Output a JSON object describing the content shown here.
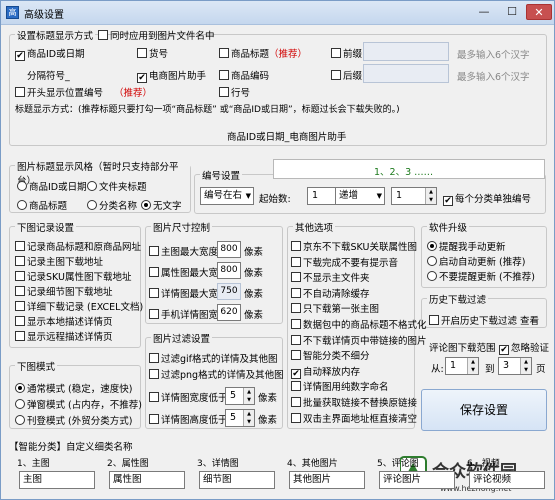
{
  "window": {
    "title": "高级设置",
    "icon": "app-icon",
    "min": "—",
    "max": "☐",
    "close": "✕"
  },
  "title_section": {
    "label": "设置标题显示方式",
    "sync_filename": "同时应用到图片文件名中",
    "cb_id_date": "商品ID或日期",
    "cb_id_date_checked": true,
    "cb_huohao": "货号",
    "cb_title": "商品标题",
    "recommend": "（推荐）",
    "cb_prefix": "前缀",
    "prefix_hint": "最多输入6个汉字",
    "separator_label": "分隔符号_",
    "cb_ec_helper": "电商图片助手",
    "cb_ec_helper_checked": true,
    "cb_code": "商品编码",
    "cb_suffix": "后缀",
    "suffix_hint": "最多输入6个汉字",
    "cb_start_num": "开头显示位置编号",
    "recommend2": "（推荐）",
    "cb_row": "行号",
    "desc": "标题显示方式：(推荐标题只要打勾一项“商品标题” 或“商品ID或日期”，标题过长会下载失败的。)",
    "preview": "商品ID或日期_电商图片助手"
  },
  "style_section": {
    "label": "图片标题显示风格（暂时只支持部分平台）",
    "opts": [
      "商品ID或日期",
      "文件夹标题",
      "商品标题",
      "分类名称",
      "无文字"
    ],
    "selected": 4,
    "numbering": {
      "label": "编号设置",
      "position": "编号在右",
      "start_label": "起始数:",
      "start": "1",
      "mode": "递增",
      "step": "1",
      "per_cat": "每个分类单独编号",
      "per_cat_checked": true
    },
    "preview": "1、2、3 ……"
  },
  "download_log": {
    "label": "下图记录设置",
    "items": [
      "记录商品标题和原商品网址",
      "记录主图下载地址",
      "记录SKU属性图下载地址",
      "记录细节图下载地址",
      "详细下载记录 (EXCEL文档)",
      "显示本地描述详情页",
      "显示远程描述详情页"
    ]
  },
  "download_mode": {
    "label": "下图模式",
    "opts": [
      "通常模式 (稳定，速度快)",
      "弹窗模式 (占内存，不推荐)",
      "刊登模式 (外贸分类方式)"
    ],
    "selected": 0
  },
  "size_section": {
    "label": "图片尺寸控制",
    "unit": "像素",
    "rows": [
      {
        "text": "主图最大宽度:",
        "val": "800",
        "checked": false,
        "disabled": false
      },
      {
        "text": "属性图最大宽度:",
        "val": "800",
        "checked": false,
        "disabled": false
      },
      {
        "text": "详情图最大宽度:",
        "val": "750",
        "checked": false,
        "disabled": true
      },
      {
        "text": "手机详情图宽度:",
        "val": "620",
        "checked": false,
        "disabled": false
      }
    ]
  },
  "filter_section": {
    "label": "图片过滤设置",
    "unit": "像素",
    "items": [
      "过滤gif格式的详情及其他图",
      "过滤png格式的详情及其他图"
    ],
    "rows": [
      {
        "text": "详情图宽度低于:",
        "val": "5"
      },
      {
        "text": "详情图高度低于:",
        "val": "5"
      }
    ]
  },
  "other_section": {
    "label": "其他选项",
    "items": [
      {
        "t": "京东不下载SKU关联属性图",
        "c": false
      },
      {
        "t": "下载完成不要有提示音",
        "c": false
      },
      {
        "t": "不显示主文件夹",
        "c": false
      },
      {
        "t": "不自动清除缓存",
        "c": false
      },
      {
        "t": "只下载第一张主图",
        "c": false
      },
      {
        "t": "数据包中的商品标题不格式化",
        "c": false
      },
      {
        "t": "不下载详情页中带链接的图片",
        "c": false
      },
      {
        "t": "智能分类不细分",
        "c": false
      },
      {
        "t": "自动释放内存",
        "c": true
      },
      {
        "t": "详情图用纯数字命名",
        "c": false
      },
      {
        "t": "批量获取链接不替换原链接",
        "c": false
      },
      {
        "t": "双击主界面地址框直接清空",
        "c": false
      }
    ]
  },
  "upgrade": {
    "label": "软件升级",
    "opts": [
      "提醒我手动更新",
      "启动自动更新 (推荐)",
      "不要提醒更新 (不推荐)"
    ],
    "selected": 0
  },
  "history": {
    "label": "历史下载过滤",
    "cb": "开启历史下载过滤",
    "link": "查看"
  },
  "comment": {
    "label": "评论图下载范围",
    "ignore": "忽略验证",
    "ignore_checked": true,
    "from": "从:",
    "from_val": "1",
    "to": "到",
    "to_val": "3",
    "page": "页"
  },
  "save_button": "保存设置",
  "smart": {
    "label": "【智能分类】自定义细类名称",
    "items": [
      {
        "n": "1、主图",
        "v": "主图"
      },
      {
        "n": "2、属性图",
        "v": "属性图"
      },
      {
        "n": "3、详情图",
        "v": "细节图"
      },
      {
        "n": "4、其他图片",
        "v": "其他图片"
      },
      {
        "n": "5、评论图",
        "v": "评论图片"
      },
      {
        "n": "6、视频",
        "v": "评论视频"
      }
    ]
  },
  "watermark": {
    "text": "合众软件园",
    "url": "www.hezhong.net"
  }
}
